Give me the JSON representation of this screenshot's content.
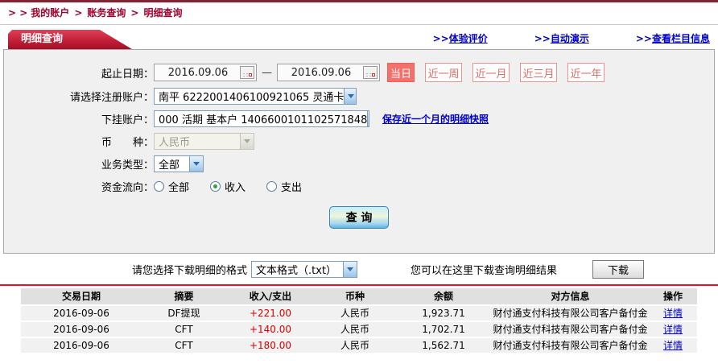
{
  "colors": {
    "top_bar": "#842433",
    "breadcrumb_red": "#a00029",
    "tab_red": "#c22038",
    "link_blue": "#0000cc",
    "quick_button_red": "#f4716b",
    "divider_red": "#e8101c",
    "amount_red": "#d80000"
  },
  "breadcrumb": {
    "prefix": "> >",
    "separator": ">",
    "items": [
      "我的账户",
      "账务查询",
      "明细查询"
    ]
  },
  "tab": {
    "title": "明细查询"
  },
  "header_links": [
    {
      "prefix": ">>",
      "label": "体验评价"
    },
    {
      "prefix": ">>",
      "label": "自动演示"
    },
    {
      "prefix": ">>",
      "label": "查看栏目信息"
    }
  ],
  "form": {
    "date_label": "起止日期：",
    "date_from": "2016.09.06",
    "date_to": "2016.09.06",
    "date_separator": "—",
    "quick_buttons": [
      {
        "label": "当日",
        "active": true
      },
      {
        "label": "近一周",
        "active": false
      },
      {
        "label": "近一月",
        "active": false
      },
      {
        "label": "近三月",
        "active": false
      },
      {
        "label": "近一年",
        "active": false
      }
    ],
    "register_account_label": "请选择注册账户：",
    "register_account_value": "南平 6222001406100921065 灵通卡",
    "sub_account_label": "下挂账户：",
    "sub_account_value": "000 活期 基本户 1406600101102571848",
    "snapshot_link": "保存近一个月的明细快照",
    "currency_label": "币　　种：",
    "currency_value": "人民币",
    "business_type_label": "业务类型：",
    "business_type_value": "全部",
    "fund_flow_label": "资金流向：",
    "fund_flow_options": [
      {
        "label": "全部",
        "checked": false
      },
      {
        "label": "收入",
        "checked": true
      },
      {
        "label": "支出",
        "checked": false
      }
    ],
    "query_button": "查 询"
  },
  "download": {
    "format_label": "请您选择下载明细的格式",
    "format_value": "文本格式（.txt）",
    "hint": "您可以在这里下载查询明细结果",
    "button": "下载"
  },
  "table": {
    "headers": [
      "交易日期",
      "摘要",
      "收入/支出",
      "币种",
      "余额",
      "对方信息",
      "操作"
    ],
    "rows": [
      {
        "date": "2016-09-06",
        "summary": "DF提现",
        "amount": "+221.00",
        "currency": "人民币",
        "balance": "1,923.71",
        "counterparty": "财付通支付科技有限公司客户备付金",
        "action": "详情"
      },
      {
        "date": "2016-09-06",
        "summary": "CFT",
        "amount": "+140.00",
        "currency": "人民币",
        "balance": "1,702.71",
        "counterparty": "财付通支付科技有限公司客户备付金",
        "action": "详情"
      },
      {
        "date": "2016-09-06",
        "summary": "CFT",
        "amount": "+180.00",
        "currency": "人民币",
        "balance": "1,562.71",
        "counterparty": "财付通支付科技有限公司客户备付金",
        "action": "详情"
      }
    ]
  }
}
